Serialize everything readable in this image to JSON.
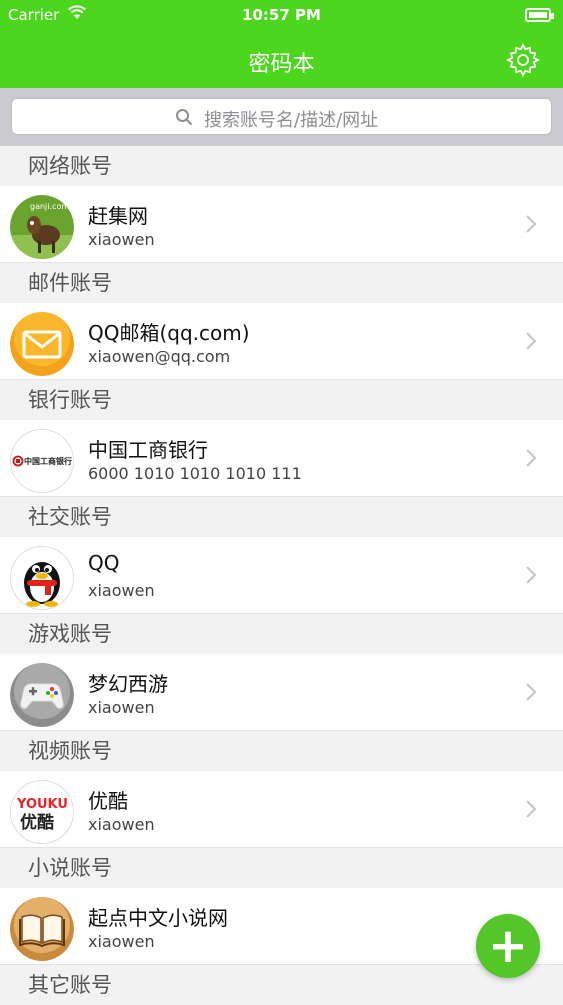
{
  "status_bar": {
    "carrier": "Carrier",
    "time": "10:57 PM",
    "wifi_icon": "wifi-icon",
    "battery_icon": "battery-icon"
  },
  "nav": {
    "title": "密码本",
    "settings_icon": "gear-icon"
  },
  "search": {
    "placeholder": "搜索账号名/描述/网址",
    "icon": "search-icon"
  },
  "sections": [
    {
      "header": "网络账号",
      "items": [
        {
          "name": "赶集网",
          "sub": "xiaowen",
          "avatar_text": "ganji.com"
        }
      ]
    },
    {
      "header": "邮件账号",
      "items": [
        {
          "name": "QQ邮箱(qq.com)",
          "sub": "xiaowen@qq.com"
        }
      ]
    },
    {
      "header": "银行账号",
      "items": [
        {
          "name": "中国工商银行",
          "sub": "6000 1010 1010 1010 111",
          "avatar_text": "中国工商银行"
        }
      ]
    },
    {
      "header": "社交账号",
      "items": [
        {
          "name": "QQ",
          "sub": "xiaowen"
        }
      ]
    },
    {
      "header": "游戏账号",
      "items": [
        {
          "name": "梦幻西游",
          "sub": "xiaowen"
        }
      ]
    },
    {
      "header": "视频账号",
      "items": [
        {
          "name": "优酷",
          "sub": "xiaowen",
          "avatar_text": "YOUKU",
          "avatar_text2": "优酷"
        }
      ]
    },
    {
      "header": "小说账号",
      "items": [
        {
          "name": "起点中文小说网",
          "sub": "xiaowen"
        }
      ]
    },
    {
      "header": "其它账号",
      "items": []
    }
  ],
  "fab": {
    "label": "+"
  },
  "colors": {
    "accent": "#4cd61e",
    "fab": "#54c62a"
  }
}
